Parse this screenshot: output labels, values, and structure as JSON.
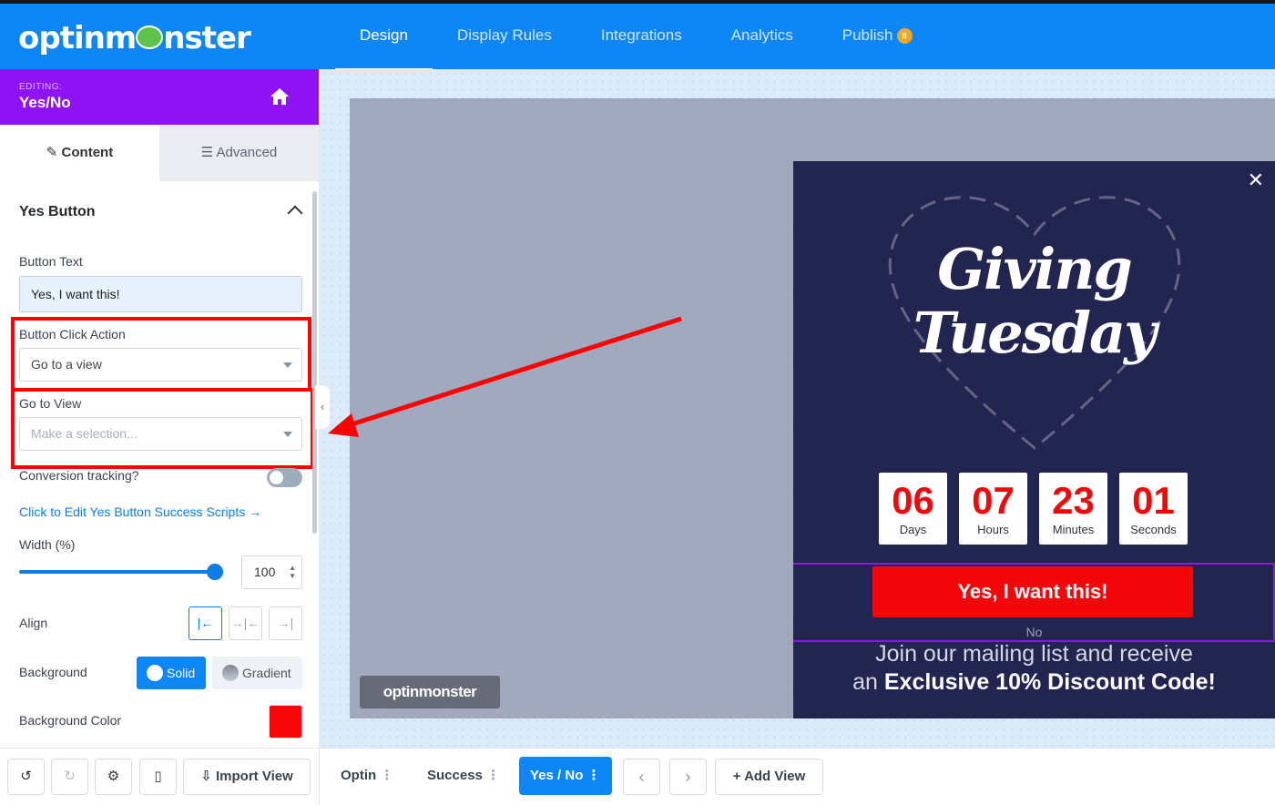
{
  "app": {
    "logo": "optinmonster"
  },
  "nav": {
    "tabs": [
      {
        "label": "Design",
        "active": true
      },
      {
        "label": "Display Rules"
      },
      {
        "label": "Integrations"
      },
      {
        "label": "Analytics"
      },
      {
        "label": "Publish",
        "badge_icon": "pause-icon"
      }
    ]
  },
  "sidebar": {
    "editing_label": "EDITING:",
    "editing_value": "Yes/No",
    "tabs": {
      "content": "Content",
      "advanced": "Advanced"
    },
    "section_title": "Yes Button",
    "button_text_label": "Button Text",
    "button_text_value": "Yes, I want this!",
    "click_action_label": "Button Click Action",
    "click_action_value": "Go to a view",
    "go_to_view_label": "Go to View",
    "go_to_view_placeholder": "Make a selection...",
    "conversion_label": "Conversion tracking?",
    "conversion_enabled": false,
    "scripts_link": "Click to Edit Yes Button Success Scripts →",
    "width_label": "Width (%)",
    "width_value": "100",
    "align_label": "Align",
    "align_selected": "left",
    "background_label": "Background",
    "bg_solid": "Solid",
    "bg_gradient": "Gradient",
    "bg_color_label": "Background Color",
    "bg_color": "#f7080a"
  },
  "footer_left": {
    "import_label": "Import View"
  },
  "footer_right": {
    "views": [
      {
        "label": "Optin"
      },
      {
        "label": "Success"
      },
      {
        "label": "Yes / No",
        "active": true
      }
    ],
    "add_view": "Add View"
  },
  "popup": {
    "title_line1": "Giving",
    "title_line2": "Tuesday",
    "countdown": [
      {
        "value": "06",
        "unit": "Days"
      },
      {
        "value": "07",
        "unit": "Hours"
      },
      {
        "value": "23",
        "unit": "Minutes"
      },
      {
        "value": "01",
        "unit": "Seconds"
      }
    ],
    "yes_button": "Yes, I want this!",
    "no_link": "No",
    "promo_line1": "Join our mailing list and receive",
    "promo_prefix": "an",
    "promo_bold": "Exclusive 10% Discount Code!"
  },
  "canvas_badge": "optinmonster",
  "colors": {
    "brand": "#0e86f5",
    "editing": "#8f13f3",
    "popup_bg": "#22254f",
    "accent_red": "#f4070b"
  }
}
